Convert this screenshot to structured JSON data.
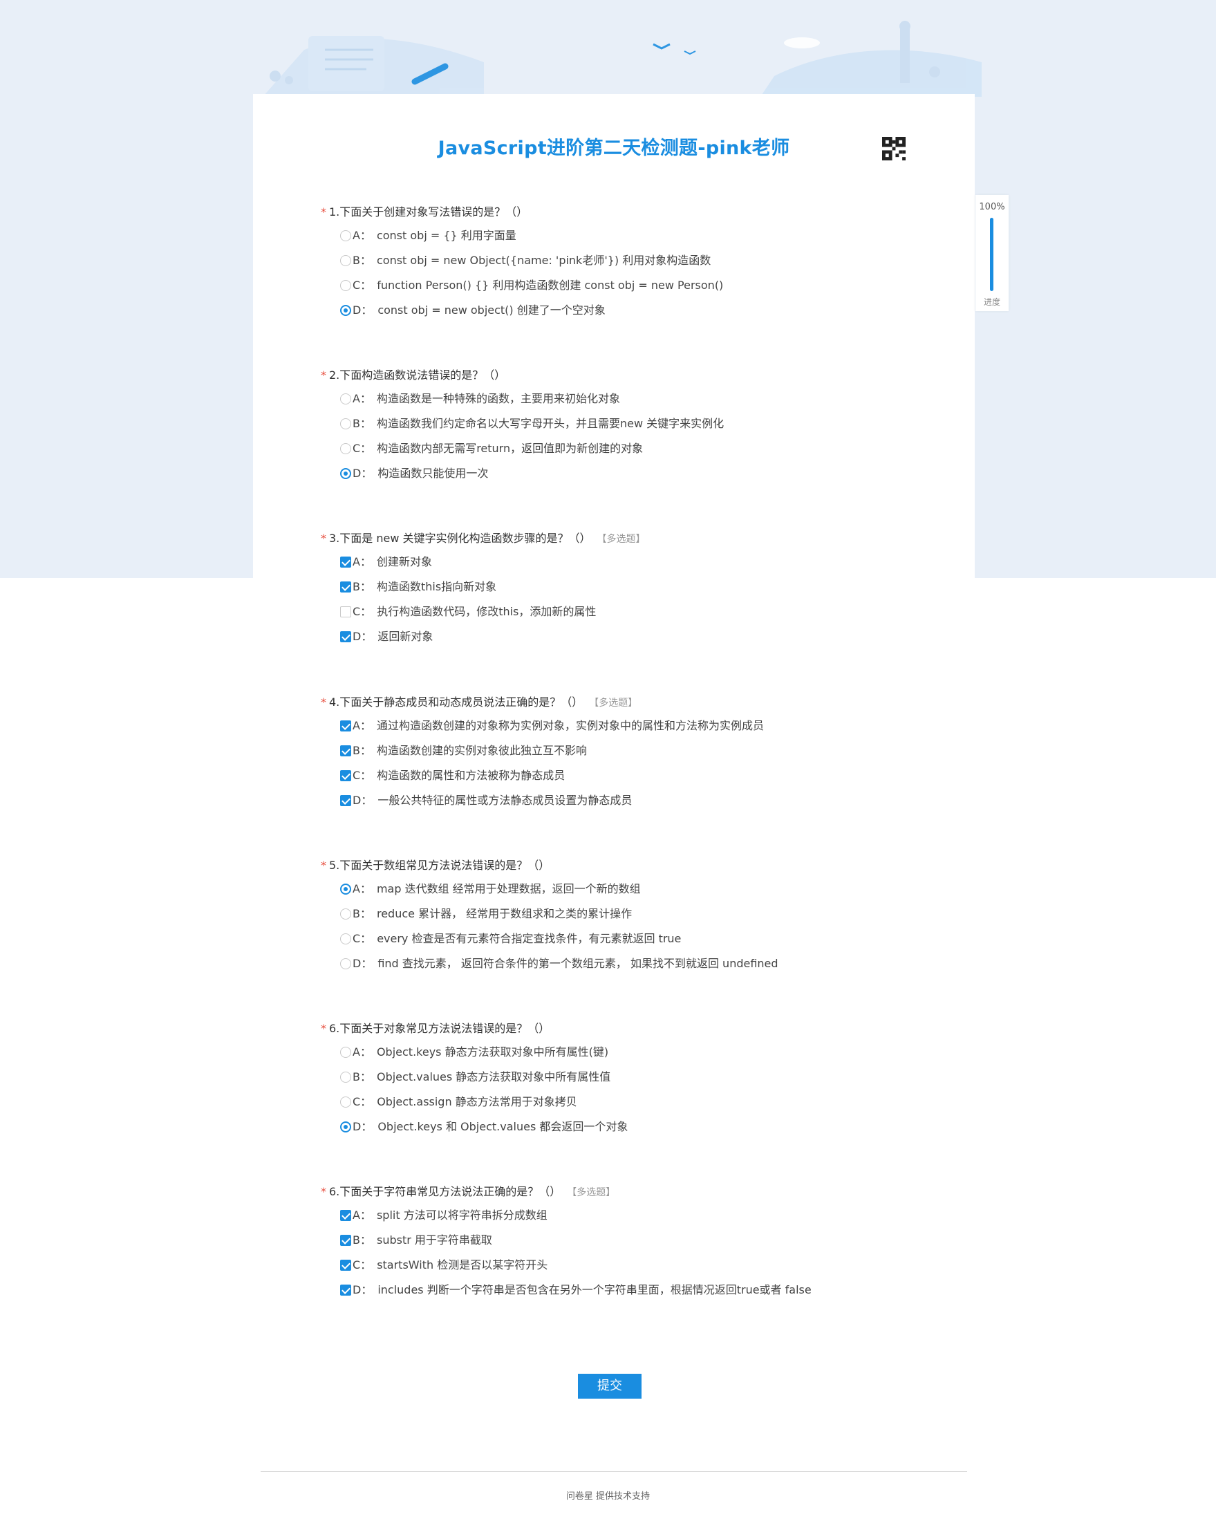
{
  "page": {
    "title": "JavaScript进阶第二天检测题-pink老师",
    "accent_color": "#1a8de0",
    "background_color": "#e8eff8",
    "qr_icon": "qr-code-icon"
  },
  "progress": {
    "percent_label": "100%",
    "percent": 100,
    "label": "进度"
  },
  "questions": [
    {
      "title": "1.下面关于创建对象写法错误的是？（）",
      "type": "single",
      "options": [
        {
          "key": "A：",
          "text": "const obj = {} 利用字面量",
          "selected": false
        },
        {
          "key": "B：",
          "text": "const obj = new Object({name: 'pink老师'}) 利用对象构造函数",
          "selected": false
        },
        {
          "key": "C：",
          "text": "function Person() {} 利用构造函数创建 const obj = new Person()",
          "selected": false
        },
        {
          "key": "D：",
          "text": "const obj = new object() 创建了一个空对象",
          "selected": true
        }
      ]
    },
    {
      "title": "2.下面构造函数说法错误的是？（）",
      "type": "single",
      "options": [
        {
          "key": "A：",
          "text": "构造函数是一种特殊的函数，主要用来初始化对象",
          "selected": false
        },
        {
          "key": "B：",
          "text": "构造函数我们约定命名以大写字母开头，并且需要new 关键字来实例化",
          "selected": false
        },
        {
          "key": "C：",
          "text": "构造函数内部无需写return，返回值即为新创建的对象",
          "selected": false
        },
        {
          "key": "D：",
          "text": "构造函数只能使用一次",
          "selected": true
        }
      ]
    },
    {
      "title": "3.下面是 new 关键字实例化构造函数步骤的是？（）",
      "type": "multi",
      "multi_label": "【多选题】",
      "options": [
        {
          "key": "A：",
          "text": "创建新对象",
          "selected": true
        },
        {
          "key": "B：",
          "text": "构造函数this指向新对象",
          "selected": true
        },
        {
          "key": "C：",
          "text": "执行构造函数代码，修改this，添加新的属性",
          "selected": false
        },
        {
          "key": "D：",
          "text": "返回新对象",
          "selected": true
        }
      ]
    },
    {
      "title": "4.下面关于静态成员和动态成员说法正确的是？（）",
      "type": "multi",
      "multi_label": "【多选题】",
      "options": [
        {
          "key": "A：",
          "text": "通过构造函数创建的对象称为实例对象，实例对象中的属性和方法称为实例成员",
          "selected": true
        },
        {
          "key": "B：",
          "text": "构造函数创建的实例对象彼此独立互不影响",
          "selected": true
        },
        {
          "key": "C：",
          "text": "构造函数的属性和方法被称为静态成员",
          "selected": true
        },
        {
          "key": "D：",
          "text": "一般公共特征的属性或方法静态成员设置为静态成员",
          "selected": true
        }
      ]
    },
    {
      "title": "5.下面关于数组常见方法说法错误的是？（）",
      "type": "single",
      "options": [
        {
          "key": "A：",
          "text": "map 迭代数组 经常用于处理数据，返回一个新的数组",
          "selected": true
        },
        {
          "key": "B：",
          "text": "reduce 累计器， 经常用于数组求和之类的累计操作",
          "selected": false
        },
        {
          "key": "C：",
          "text": "every 检查是否有元素符合指定查找条件，有元素就返回 true",
          "selected": false
        },
        {
          "key": "D：",
          "text": "find 查找元素， 返回符合条件的第一个数组元素， 如果找不到就返回 undefined",
          "selected": false
        }
      ]
    },
    {
      "title": "6.下面关于对象常见方法说法错误的是？（）",
      "type": "single",
      "options": [
        {
          "key": "A：",
          "text": "Object.keys 静态方法获取对象中所有属性(键)",
          "selected": false
        },
        {
          "key": "B：",
          "text": "Object.values 静态方法获取对象中所有属性值",
          "selected": false
        },
        {
          "key": "C：",
          "text": "Object.assign 静态方法常用于对象拷贝",
          "selected": false
        },
        {
          "key": "D：",
          "text": "Object.keys 和 Object.values 都会返回一个对象",
          "selected": true
        }
      ]
    },
    {
      "title": "6.下面关于字符串常见方法说法正确的是？（）",
      "type": "multi",
      "multi_label": "【多选题】",
      "options": [
        {
          "key": "A：",
          "text": "split 方法可以将字符串拆分成数组",
          "selected": true
        },
        {
          "key": "B：",
          "text": "substr 用于字符串截取",
          "selected": true
        },
        {
          "key": "C：",
          "text": "startsWith 检测是否以某字符开头",
          "selected": true
        },
        {
          "key": "D：",
          "text": "includes 判断一个字符串是否包含在另外一个字符串里面，根据情况返回true或者 false",
          "selected": true
        }
      ]
    }
  ],
  "required_mark": "*",
  "submit_label": "提交",
  "footer_text": "问卷星 提供技术支持"
}
